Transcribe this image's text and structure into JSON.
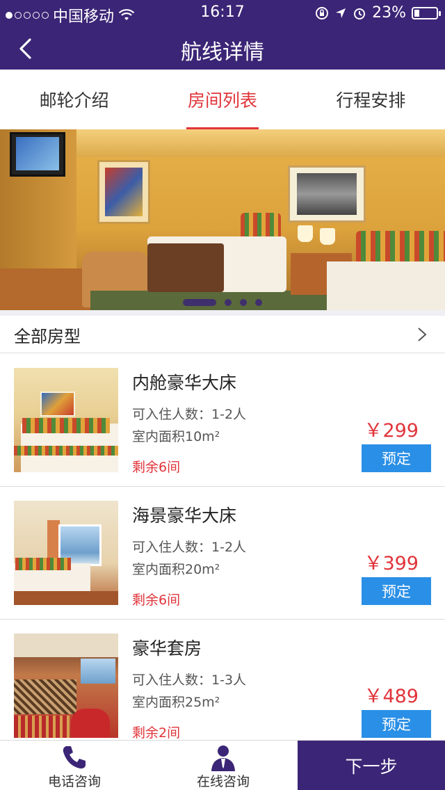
{
  "status_bar": {
    "carrier": "中国移动",
    "time": "16:17",
    "battery": "23%",
    "battery_level": 0.23
  },
  "nav": {
    "title": "航线详情"
  },
  "tabs": [
    {
      "label": "邮轮介绍",
      "active": false
    },
    {
      "label": "房间列表",
      "active": true
    },
    {
      "label": "行程安排",
      "active": false
    }
  ],
  "banner": {
    "page_count": 4,
    "active_page": 1
  },
  "section": {
    "title": "全部房型"
  },
  "rooms": [
    {
      "name": "内舱豪华大床",
      "capacity": "可入住人数：1-2人",
      "area": "室内面积10m²",
      "remaining": "剩余6间",
      "price": "￥299",
      "book_label": "预定"
    },
    {
      "name": "海景豪华大床",
      "capacity": "可入住人数：1-2人",
      "area": "室内面积20m²",
      "remaining": "剩余6间",
      "price": "￥399",
      "book_label": "预定"
    },
    {
      "name": "豪华套房",
      "capacity": "可入住人数：1-3人",
      "area": "室内面积25m²",
      "remaining": "剩余2间",
      "price": "￥489",
      "book_label": "预定"
    }
  ],
  "bottom_bar": {
    "phone_label": "电话咨询",
    "online_label": "在线咨询",
    "next_label": "下一步"
  },
  "colors": {
    "brand": "#3b2576",
    "accent_red": "#e0343a",
    "button_blue": "#2a8fe6"
  }
}
